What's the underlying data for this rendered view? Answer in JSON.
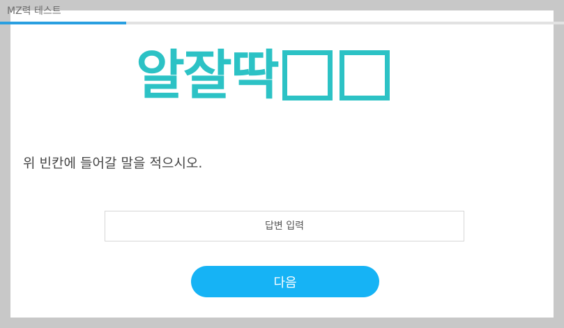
{
  "header": {
    "title": "MZ력 테스트"
  },
  "progress": {
    "fraction": 0.224,
    "color": "#2a9fe0",
    "track_color": "#e2e2e2"
  },
  "quiz": {
    "word_prefix": "알잘딱",
    "blank_count": 2,
    "accent_color": "#2cc2c5",
    "question": "위 빈칸에 들어갈 말을 적으시오."
  },
  "answer": {
    "placeholder": "답변 입력",
    "value": ""
  },
  "next_button": {
    "label": "다음",
    "color": "#16b3f5"
  }
}
